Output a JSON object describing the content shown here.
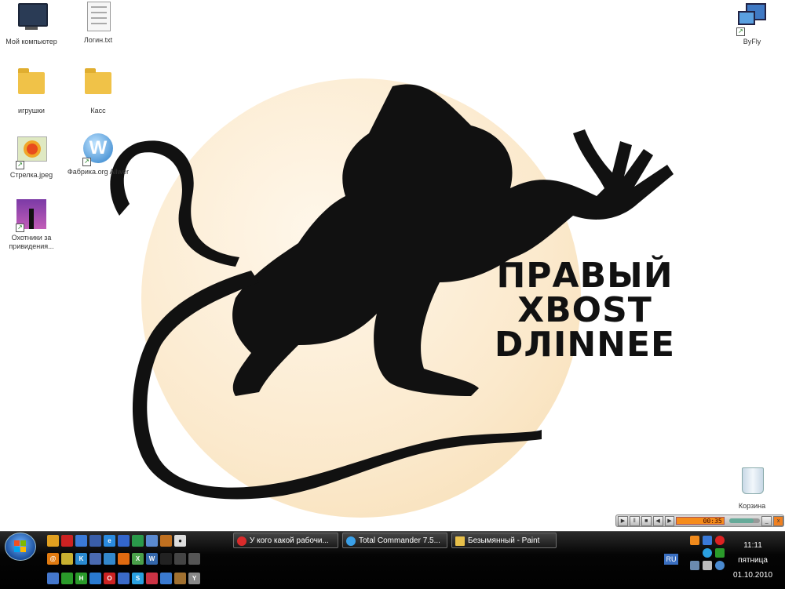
{
  "desktop": {
    "icons": [
      {
        "name": "my-computer",
        "label": "Мой компьютер"
      },
      {
        "name": "login-txt",
        "label": "Логин.txt"
      },
      {
        "name": "games-folder",
        "label": "игрушки"
      },
      {
        "name": "kacc-folder",
        "label": "Касс"
      },
      {
        "name": "flower-jpeg",
        "label": "Стрелка.jpeg"
      },
      {
        "name": "fabrika-shortcut",
        "label": "Фабрика.org Allwer"
      },
      {
        "name": "ghost-hunters-shortcut",
        "label": "Охотники за привидения..."
      },
      {
        "name": "byfly-shortcut",
        "label": "ByFly"
      },
      {
        "name": "recycle-bin",
        "label": "Корзина"
      }
    ],
    "wallpaper": {
      "line1": "ПРАВЫЙ",
      "line2": "XBOST",
      "line3": "DЛINNEE"
    }
  },
  "media_widget": {
    "time": "00:35",
    "volume": 0.8
  },
  "taskbar": {
    "windows": [
      {
        "label": "У кого какой рабочи...",
        "icon_color": "#d92b2b"
      },
      {
        "label": "Total Commander 7.5...",
        "icon_color": "#3aa0e8"
      },
      {
        "label": "Безымянный - Paint",
        "icon_color": "#e8c04a"
      }
    ],
    "language": "RU",
    "clock": {
      "time": "11:11",
      "day": "пятница",
      "date": "01.10.2010"
    }
  },
  "colors": {
    "taskbar_bg": "#000000",
    "wallpaper_sun": "#fbe9cc",
    "start_orb": "#1b4f9c"
  }
}
